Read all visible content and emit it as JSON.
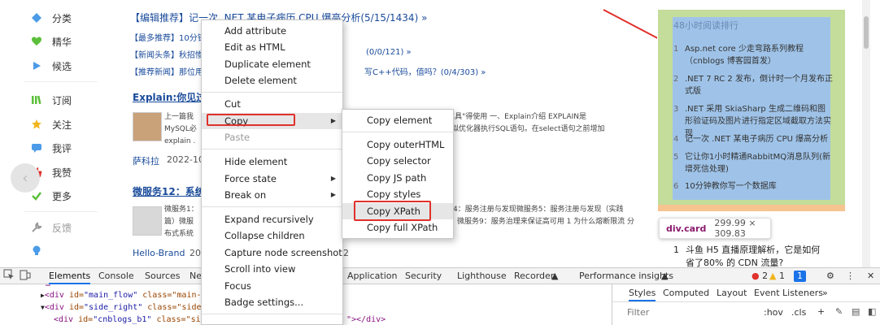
{
  "nav": {
    "items": [
      {
        "label": "分类",
        "icon": "diamond-icon",
        "color": "#4c9be8"
      },
      {
        "label": "精华",
        "icon": "heart-icon",
        "color": "#5cbf3a"
      },
      {
        "label": "候选",
        "icon": "play-icon",
        "color": "#4c9be8"
      },
      {
        "label": "订阅",
        "icon": "books-icon",
        "color": "#5cbf3a"
      },
      {
        "label": "关注",
        "icon": "star-icon",
        "color": "#f1b51c"
      },
      {
        "label": "我评",
        "icon": "comment-icon",
        "color": "#4c9be8"
      },
      {
        "label": "我赞",
        "icon": "thumb-up-icon",
        "color": "#e0312c"
      },
      {
        "label": "更多",
        "icon": "check-icon",
        "color": "#5cbf3a"
      },
      {
        "label": "反馈",
        "icon": "wrench-icon",
        "color": "#999999"
      }
    ]
  },
  "main": {
    "news": [
      "【编辑推荐】记一次 .NET 某电子病历 CPU 爆高分析(5/15/1434) »",
      "【最多推荐】10分钟",
      "【新闻头条】秋招惨",
      "【推荐新闻】那位用"
    ],
    "news_tails": [
      "(0/0/121) »",
      "写C++代码，值吗？(0/4/303) »"
    ],
    "articles": [
      {
        "title": "Explain:你见过",
        "body_left": "上一篇我",
        "body_left2": "MySQL必",
        "body_left3": "explain .",
        "body_right": "相关\"工具\"得使用 一、Explain介绍 EXPLAIN是",
        "body_right2": "者说模拟优化器执行SQL语句。在select语句之前增加",
        "author": "萨科拉",
        "date": "2022-10"
      },
      {
        "title": "微服务12：系统",
        "body_left": "微服务1：",
        "body_left2": "篇）微服",
        "body_left3": "布式系统",
        "body_right": "务4：服务注册与发现微服务5：服务注册与发现（实践",
        "body_right2": "微服务9：服务治理来保证高可用 1 为什么熔断限流 分",
        "author": "Hello-Brand",
        "date": "20",
        "date_tail": "2"
      }
    ]
  },
  "right": {
    "title": "48小时阅读排行",
    "items": [
      {
        "num": "1",
        "text": "Asp.net core 少走弯路系列教程（cnblogs 博客园首发）"
      },
      {
        "num": "2",
        "text": ".NET 7 RC 2 发布，倒计时一个月发布正式版"
      },
      {
        "num": "3",
        "text": ".NET 采用 SkiaSharp 生成二维码和图形验证码及图片进行指定区域截取方法实现"
      },
      {
        "num": "4",
        "text": "记一次 .NET 某电子病历 CPU 爆高分析"
      },
      {
        "num": "5",
        "text": "它让你1小时精通RabbitMQ消息队列(新增死信处理)"
      },
      {
        "num": "6",
        "text": "10分钟教你写一个数据库"
      }
    ],
    "tooltip_tag": "div.card",
    "tooltip_size": "299.99 × 309.83",
    "below": {
      "num": "1",
      "text": "斗鱼 H5 直播原理解析，它是如何省了80% 的 CDN 流量?"
    }
  },
  "menu1": {
    "items": [
      {
        "label": "Add attribute"
      },
      {
        "label": "Edit as HTML"
      },
      {
        "label": "Duplicate element"
      },
      {
        "label": "Delete element"
      },
      {
        "label": "Cut"
      },
      {
        "label": "Copy"
      },
      {
        "label": "Paste"
      },
      {
        "label": "Hide element"
      },
      {
        "label": "Force state"
      },
      {
        "label": "Break on"
      },
      {
        "label": "Expand recursively"
      },
      {
        "label": "Collapse children"
      },
      {
        "label": "Capture node screenshot"
      },
      {
        "label": "Scroll into view"
      },
      {
        "label": "Focus"
      },
      {
        "label": "Badge settings..."
      }
    ]
  },
  "menu2": {
    "items": [
      {
        "label": "Copy element"
      },
      {
        "label": "Copy outerHTML"
      },
      {
        "label": "Copy selector"
      },
      {
        "label": "Copy JS path"
      },
      {
        "label": "Copy styles"
      },
      {
        "label": "Copy XPath"
      },
      {
        "label": "Copy full XPath"
      }
    ]
  },
  "devtools": {
    "tabs": [
      "Elements",
      "Console",
      "Sources",
      "Ne",
      "Application",
      "Security",
      "Lighthouse",
      "Recorder",
      "Performance insights"
    ],
    "errors": "2",
    "warnings": "1",
    "messages": "1",
    "dom": {
      "l1_tag": "<div",
      "l1_attr": " id=",
      "l1_val": "\"main_flow\"",
      "l1_rest": " class=\"main-f",
      "l2_tag": "<div",
      "l2_attr": " id=",
      "l2_val": "\"side_right\"",
      "l2_rest": " class=\"side-r",
      "l3_tag": "<div",
      "l3_attr": " id=",
      "l3_val": "\"cnblogs_b1\"",
      "l3_rest": " class=\"side",
      "l3_end": "\"></div>"
    },
    "styles": {
      "tabs": [
        "Styles",
        "Computed",
        "Layout",
        "Event Listeners",
        "»"
      ],
      "filter_placeholder": "Filter",
      "hov": ":hov",
      "cls": ".cls",
      "plus": "+"
    }
  }
}
